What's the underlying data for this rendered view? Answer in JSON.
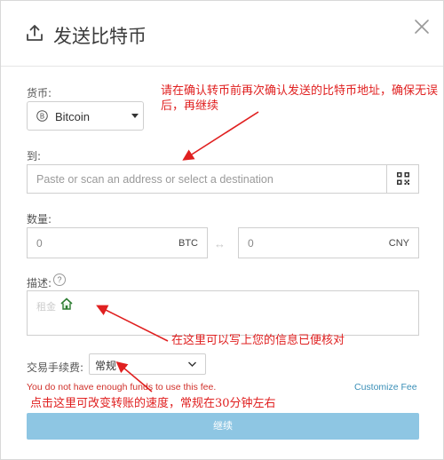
{
  "dialog": {
    "title": "发送比特币",
    "close_icon": "close-icon",
    "upload_icon": "upload-icon"
  },
  "currency": {
    "label": "货币:",
    "selected": "Bitcoin",
    "icon": "bitcoin-icon"
  },
  "to": {
    "label": "到:",
    "placeholder": "Paste or scan an address or select a destination",
    "qr_icon": "qr-code-icon"
  },
  "amount": {
    "label": "数量:",
    "btc_value": "0",
    "btc_unit": "BTC",
    "cny_value": "0",
    "cny_unit": "CNY",
    "swap_symbol": "↔"
  },
  "description": {
    "label": "描述:",
    "help_symbol": "?",
    "placeholder": "租金"
  },
  "fee": {
    "label": "交易手续费:",
    "selected": "常规"
  },
  "messages": {
    "insufficient_funds": "You do not have enough funds to use this fee.",
    "customize_fee": "Customize Fee"
  },
  "continue_button": "继续",
  "annotations": {
    "confirm_address": "请在确认转币前再次确认发送的比特币地址，确保无误后，再继续",
    "note_here": "在这里可以写上您的信息已便核对",
    "fee_hint": "点击这里可改变转账的速度，常规在30分钟左右"
  },
  "colors": {
    "annotation_red": "#e02020",
    "warning_red": "#d0302a",
    "link_blue": "#3a8fb7",
    "button_blue": "#8ec6e3"
  }
}
